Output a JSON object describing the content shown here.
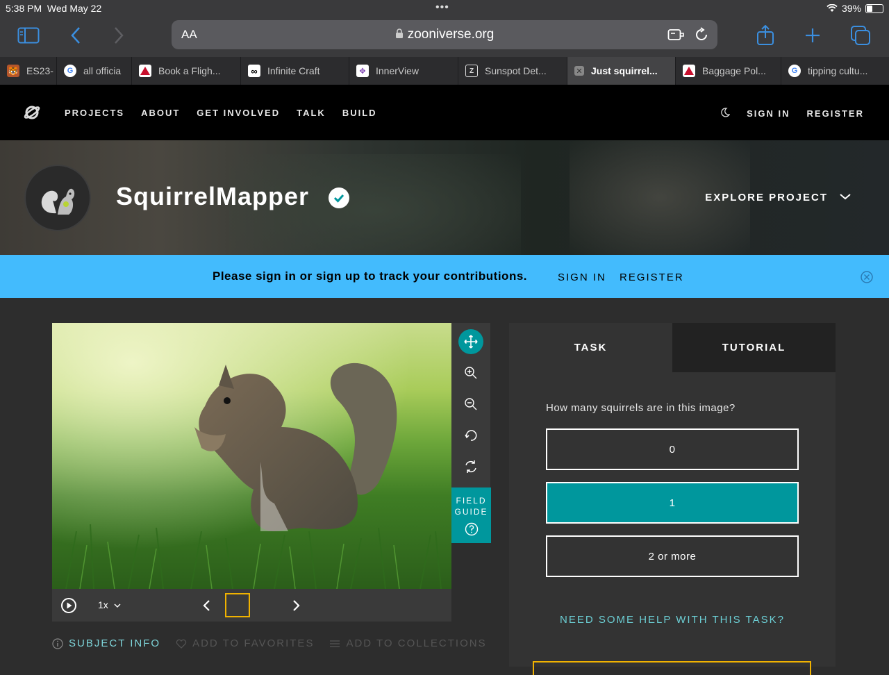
{
  "status_bar": {
    "time": "5:38 PM",
    "date": "Wed May 22",
    "battery": "39%",
    "battery_level": 0.39
  },
  "browser": {
    "text_size_label": "AA",
    "url": "zooniverse.org",
    "tabs": [
      {
        "label": "ES23-",
        "favicon": "tiger-favicon",
        "color": "#b5562b"
      },
      {
        "label": "all officia",
        "favicon": "google-favicon",
        "color": "#ffffff"
      },
      {
        "label": "Book a Fligh...",
        "favicon": "delta-favicon",
        "color": "#c8102e"
      },
      {
        "label": "Infinite Craft",
        "favicon": "infinity-favicon",
        "color": "#ffffff"
      },
      {
        "label": "InnerView",
        "favicon": "innerview-favicon",
        "color": "#7b3fb0"
      },
      {
        "label": "Sunspot Det...",
        "favicon": "zooniverse-favicon",
        "color": "#2c2c2e"
      },
      {
        "label": "Just squirrel...",
        "favicon": "close-favicon",
        "color": "#888888",
        "active": true
      },
      {
        "label": "Baggage Pol...",
        "favicon": "delta-favicon",
        "color": "#c8102e"
      },
      {
        "label": "tipping cultu...",
        "favicon": "google-favicon",
        "color": "#ffffff"
      }
    ]
  },
  "nav": {
    "links": [
      "PROJECTS",
      "ABOUT",
      "GET INVOLVED",
      "TALK",
      "BUILD"
    ],
    "sign_in": "SIGN IN",
    "register": "REGISTER"
  },
  "project": {
    "title": "SquirrelMapper",
    "explore": "EXPLORE PROJECT"
  },
  "banner": {
    "message": "Please sign in or sign up to track your contributions.",
    "sign_in": "SIGN IN",
    "register": "REGISTER"
  },
  "viewer": {
    "field_guide_line1": "FIELD",
    "field_guide_line2": "GUIDE",
    "speed": "1x",
    "subject_info": "SUBJECT INFO",
    "add_to_favorites": "ADD TO FAVORITES",
    "add_to_collections": "ADD TO COLLECTIONS"
  },
  "task": {
    "tab_task": "TASK",
    "tab_tutorial": "TUTORIAL",
    "question": "How many squirrels are in this image?",
    "answers": [
      "0",
      "1",
      "2 or more"
    ],
    "selected_answer": "1",
    "help": "NEED SOME HELP WITH THIS TASK?"
  },
  "colors": {
    "accent": "#00979d",
    "banner": "#43bbfd",
    "highlight": "#f0b200",
    "help_link": "#6ccfd5"
  }
}
